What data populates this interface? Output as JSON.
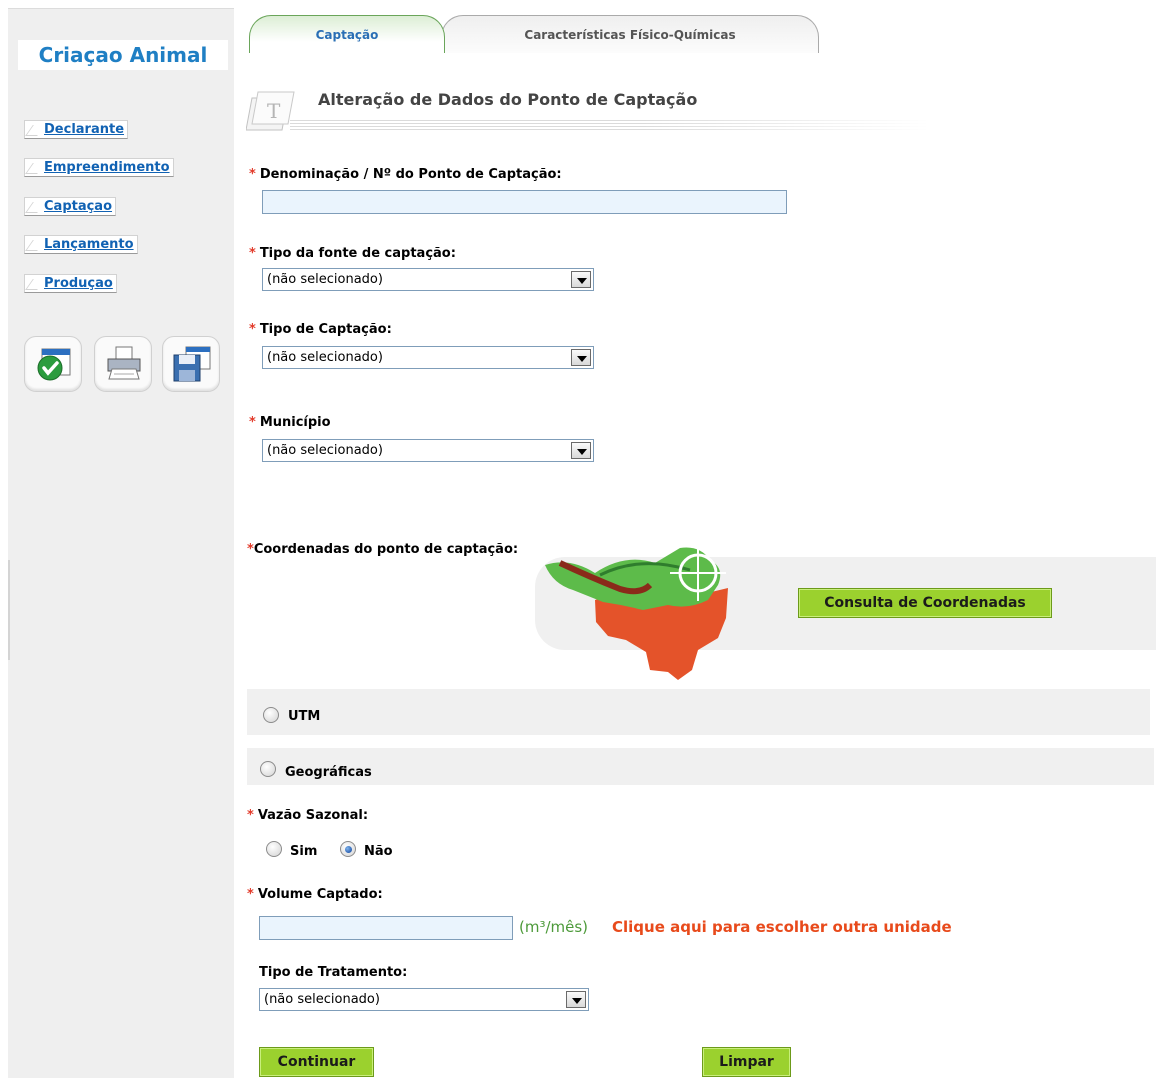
{
  "sidebar": {
    "title": "Criaçao Animal",
    "links": [
      "Declarante",
      "Empreendimento",
      "Captaçao",
      "Lançamento",
      "Produçao"
    ],
    "tools": [
      "check-window-icon",
      "printer-icon",
      "floppy-save-icon"
    ]
  },
  "tabs": [
    "Captação",
    "Características Físico-Químicas"
  ],
  "header": {
    "title": "Alteração de Dados do Ponto de Captação",
    "icon": "T"
  },
  "form": {
    "required_mark": "*",
    "denominacao": {
      "label": "Denominação / Nº do Ponto de Captação:",
      "value": ""
    },
    "tipo_fonte": {
      "label": "Tipo da fonte de captação:",
      "value": "(não selecionado)"
    },
    "tipo_captacao": {
      "label": "Tipo de Captação:",
      "value": "(não selecionado)"
    },
    "municipio": {
      "label": "Município",
      "value": "(não selecionado)"
    },
    "coordenadas": {
      "label": "Coordenadas do ponto de captação:",
      "button": "Consulta de Coordenadas",
      "options": [
        {
          "label": "UTM",
          "checked": false
        },
        {
          "label": "Geográficas",
          "checked": false
        }
      ]
    },
    "vazao_sazonal": {
      "label": "Vazão Sazonal:",
      "options": [
        {
          "label": "Sim",
          "checked": false
        },
        {
          "label": "Não",
          "checked": true
        }
      ]
    },
    "volume_captado": {
      "label": "Volume Captado:",
      "value": "",
      "unit": "(m³/mês)",
      "unit_link": "Clique aqui para escolher outra unidade"
    },
    "tipo_tratamento": {
      "label": "Tipo de Tratamento:",
      "value": "(não selecionado)"
    }
  },
  "actions": {
    "continue": "Continuar",
    "clear": "Limpar"
  },
  "colors": {
    "accent_green": "#9bd12e",
    "link_blue": "#1162b3",
    "title_blue": "#1f7fc4",
    "required_red": "#e23a2a",
    "unit_link": "#e84a1b"
  }
}
